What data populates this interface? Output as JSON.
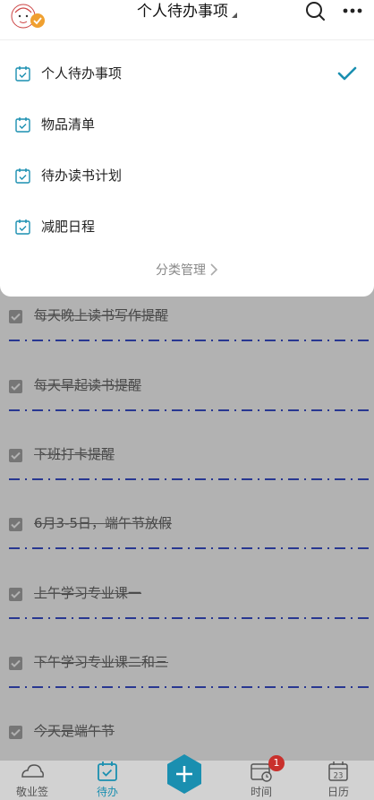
{
  "header": {
    "title": "个人待办事项"
  },
  "dropdown": {
    "items": [
      {
        "label": "个人待办事项",
        "selected": true
      },
      {
        "label": "物品清单",
        "selected": false
      },
      {
        "label": "待办读书计划",
        "selected": false
      },
      {
        "label": "减肥日程",
        "selected": false
      }
    ],
    "manage_label": "分类管理"
  },
  "todos": [
    {
      "text": "每天晚上读书写作提醒",
      "done": true
    },
    {
      "text": "每天早起读书提醒",
      "done": true
    },
    {
      "text": "下班打卡提醒",
      "done": true
    },
    {
      "text": "6月3-5日，端午节放假",
      "done": true
    },
    {
      "text": "上午学习专业课一",
      "done": true
    },
    {
      "text": "下午学习专业课二和三",
      "done": true
    },
    {
      "text": "今天是端午节",
      "done": true
    }
  ],
  "bottom_nav": {
    "items": [
      {
        "label": "敬业签",
        "icon": "cloud-icon"
      },
      {
        "label": "待办",
        "icon": "todo-calendar-icon",
        "active": true
      },
      {
        "label": "",
        "icon": "add-icon"
      },
      {
        "label": "时间",
        "icon": "clock-calendar-icon",
        "badge": "1"
      },
      {
        "label": "日历",
        "icon": "calendar-icon",
        "day": "23"
      }
    ]
  },
  "colors": {
    "accent": "#1a8fb0",
    "divider": "#3a4fd0",
    "badge": "#c9302c"
  }
}
